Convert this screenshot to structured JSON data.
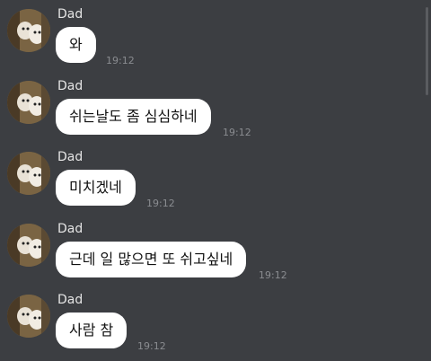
{
  "colors": {
    "background": "#3c3e42",
    "bubble": "#ffffff",
    "bubble_text": "#111111",
    "sender_text": "#e4e4e4",
    "time_text": "#8a8c90"
  },
  "messages": [
    {
      "sender": "Dad",
      "text": "와",
      "time": "19:12",
      "avatar_icon": "dog-photo-avatar"
    },
    {
      "sender": "Dad",
      "text": "쉬는날도 좀 심심하네",
      "time": "19:12",
      "avatar_icon": "dog-photo-avatar"
    },
    {
      "sender": "Dad",
      "text": "미치겠네",
      "time": "19:12",
      "avatar_icon": "dog-photo-avatar"
    },
    {
      "sender": "Dad",
      "text": "근데 일 많으면 또 쉬고싶네",
      "time": "19:12",
      "avatar_icon": "dog-photo-avatar"
    },
    {
      "sender": "Dad",
      "text": "사람 참",
      "time": "19:12",
      "avatar_icon": "dog-photo-avatar"
    }
  ]
}
